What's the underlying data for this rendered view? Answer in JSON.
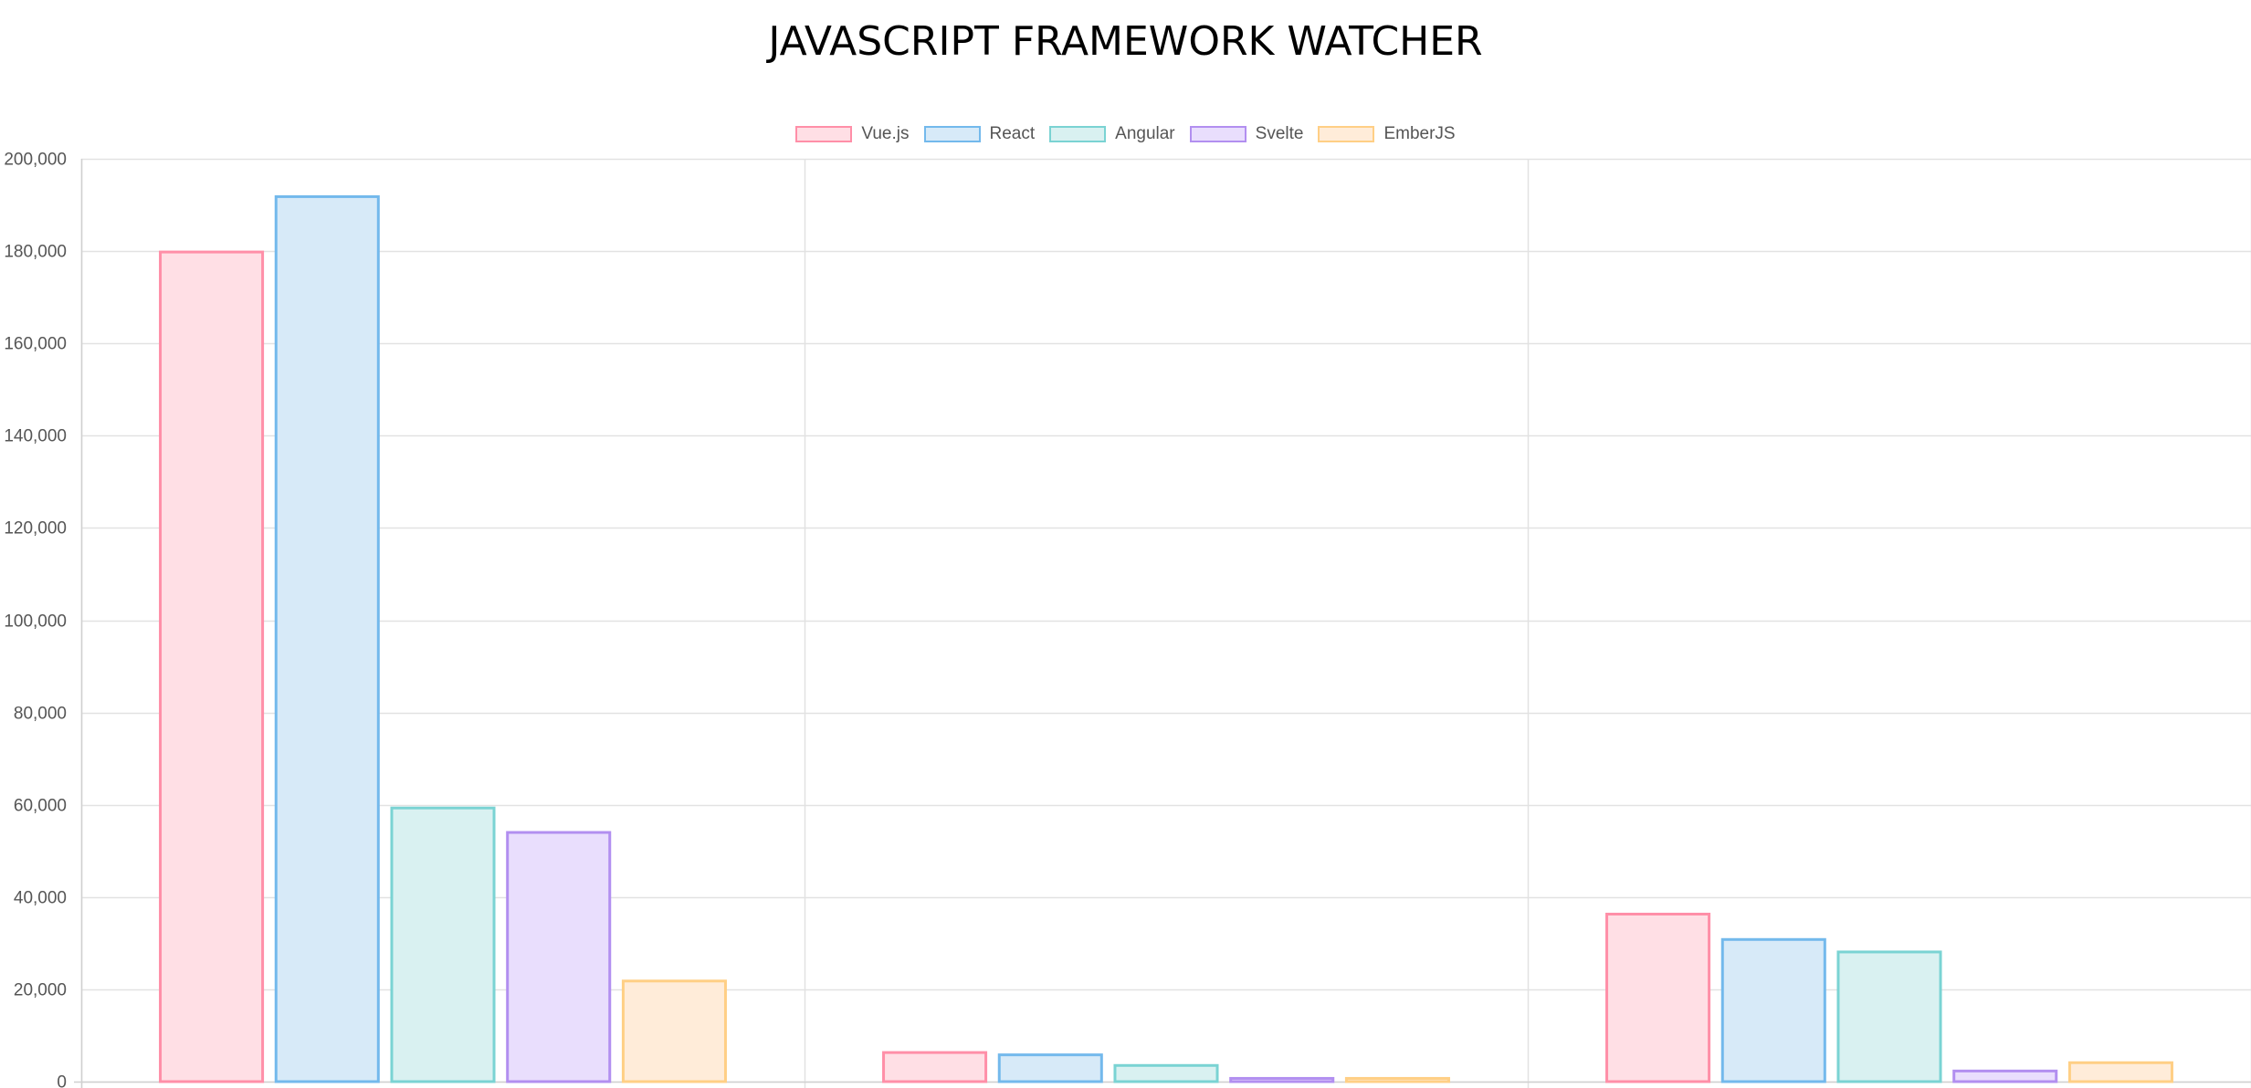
{
  "page": {
    "title": "JAVASCRIPT FRAMEWORK WATCHER"
  },
  "chart_data": {
    "type": "bar",
    "title": "JAVASCRIPT FRAMEWORK WATCHER",
    "xlabel": "",
    "ylabel": "",
    "categories": [
      "",
      "",
      ""
    ],
    "ylim": [
      0,
      200000
    ],
    "yticks": [
      "0",
      "20,000",
      "40,000",
      "60,000",
      "80,000",
      "100,000",
      "120,000",
      "140,000",
      "160,000",
      "180,000",
      "200,000"
    ],
    "grid": true,
    "legend_position": "top-center",
    "series": [
      {
        "name": "Vue.js",
        "fill": "#ffdfe5",
        "stroke": "#ff8fa8",
        "values": [
          180000,
          6500,
          36500
        ]
      },
      {
        "name": "React",
        "fill": "#d7eaf8",
        "stroke": "#73b9ec",
        "values": [
          192000,
          6000,
          31000
        ]
      },
      {
        "name": "Angular",
        "fill": "#d9f1f1",
        "stroke": "#7ad3d3",
        "values": [
          59500,
          3700,
          28300
        ]
      },
      {
        "name": "Svelte",
        "fill": "#e9defd",
        "stroke": "#b28ff0",
        "values": [
          54200,
          900,
          2500
        ]
      },
      {
        "name": "EmberJS",
        "fill": "#ffecd9",
        "stroke": "#ffcf85",
        "values": [
          22000,
          900,
          4300
        ]
      }
    ]
  }
}
